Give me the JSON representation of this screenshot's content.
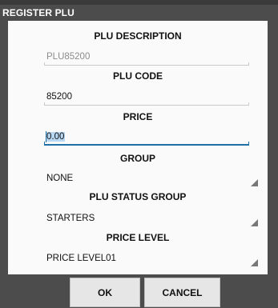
{
  "dialog": {
    "title": "REGISTER PLU"
  },
  "form": {
    "description": {
      "label": "PLU DESCRIPTION",
      "value": "PLU85200",
      "state": "disabled"
    },
    "code": {
      "label": "PLU CODE",
      "value": "85200"
    },
    "price": {
      "label": "PRICE",
      "value": "0.00",
      "state": "focused-selected"
    },
    "group": {
      "label": "GROUP",
      "value": "NONE"
    },
    "status_group": {
      "label": "PLU STATUS GROUP",
      "value": "STARTERS"
    },
    "price_level": {
      "label": "PRICE LEVEL",
      "value": "PRICE LEVEL01"
    }
  },
  "buttons": {
    "ok": "OK",
    "cancel": "CANCEL"
  },
  "colors": {
    "frame": "#4c4c4c",
    "focus_accent": "#1d6fa5",
    "selection": "#b7d7f2"
  }
}
